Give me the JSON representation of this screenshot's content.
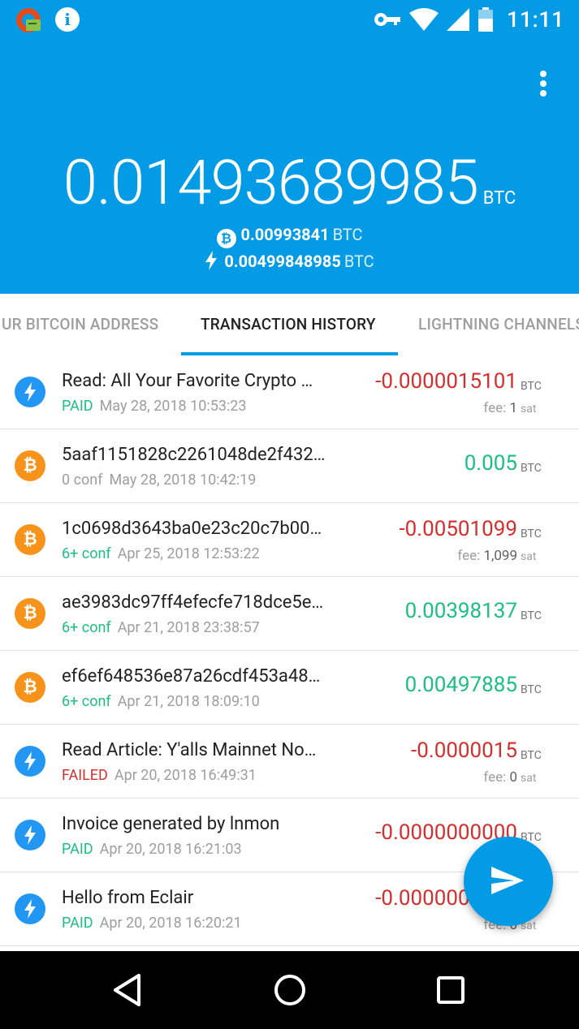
{
  "status_bar": {
    "time": "11:11",
    "icons": [
      "app-notification-icon",
      "info-icon",
      "vpn-key-icon",
      "wifi-icon",
      "signal-icon",
      "battery-icon"
    ]
  },
  "header": {
    "balance": "0.01493689985",
    "balance_unit": "BTC",
    "onchain_balance": "0.00993841",
    "onchain_unit": "BTC",
    "lightning_balance": "0.00499848985",
    "lightning_unit": "BTC"
  },
  "tabs": [
    {
      "label": "UR BITCOIN ADDRESS"
    },
    {
      "label": "TRANSACTION HISTORY",
      "active": true
    },
    {
      "label": "LIGHTNING CHANNELS"
    }
  ],
  "transactions": [
    {
      "type": "lightning",
      "title": "Read: All Your Favorite Crypto …",
      "status": "PAID",
      "date": "May 28, 2018 10:53:23",
      "amount": "-0.0000015101",
      "unit": "BTC",
      "fee_label": "fee:",
      "fee": "1",
      "fee_unit": "sat"
    },
    {
      "type": "bitcoin",
      "title": "5aaf1151828c2261048de2f432…",
      "status": "0 conf",
      "date": "May 28, 2018 10:42:19",
      "amount": "0.005",
      "unit": "BTC"
    },
    {
      "type": "bitcoin",
      "title": "1c0698d3643ba0e23c20c7b00…",
      "status": "6+ conf",
      "date": "Apr 25, 2018 12:53:22",
      "amount": "-0.00501099",
      "unit": "BTC",
      "fee_label": "fee:",
      "fee": "1,099",
      "fee_unit": "sat"
    },
    {
      "type": "bitcoin",
      "title": "ae3983dc97ff4efecfe718dce5e…",
      "status": "6+ conf",
      "date": "Apr 21, 2018 23:38:57",
      "amount": "0.00398137",
      "unit": "BTC"
    },
    {
      "type": "bitcoin",
      "title": "ef6ef648536e87a26cdf453a48…",
      "status": "6+ conf",
      "date": "Apr 21, 2018 18:09:10",
      "amount": "0.00497885",
      "unit": "BTC"
    },
    {
      "type": "lightning",
      "title": "Read Article: Y'alls Mainnet No…",
      "status": "FAILED",
      "date": "Apr 20, 2018 16:49:31",
      "amount": "-0.0000015",
      "unit": "BTC",
      "fee_label": "fee:",
      "fee": "0",
      "fee_unit": "sat"
    },
    {
      "type": "lightning",
      "title": "Invoice generated by lnmon",
      "status": "PAID",
      "date": "Apr 20, 2018 16:21:03",
      "amount": "-0.0000000000",
      "unit": "BTC"
    },
    {
      "type": "lightning",
      "title": "Hello from Eclair",
      "status": "PAID",
      "date": "Apr 20, 2018 16:20:21",
      "amount": "-0.0000000001",
      "unit": "BTC",
      "fee_label": "fee:",
      "fee": "0",
      "fee_unit": "sat"
    }
  ],
  "colors": {
    "primary": "#039BE5",
    "positive": "#1DBE83",
    "negative": "#D32F2F",
    "bitcoin": "#F7931A",
    "lightning": "#2196F3"
  }
}
